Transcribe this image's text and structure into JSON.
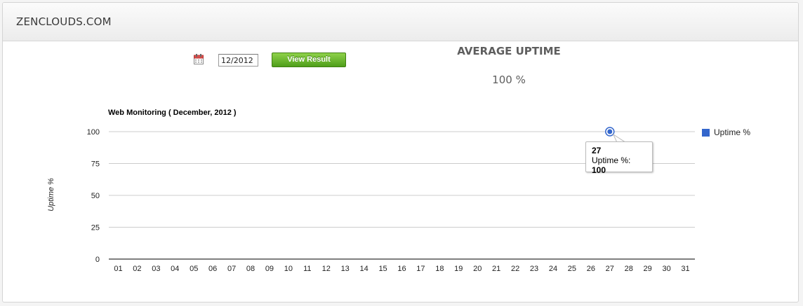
{
  "header": {
    "site_title": "ZENCLOUDS.COM"
  },
  "filter": {
    "calendar_icon": "calendar-icon",
    "month_value": "12/2012",
    "view_button_label": "View Result"
  },
  "summary": {
    "heading": "AVERAGE UPTIME",
    "value": "100 %"
  },
  "colors": {
    "series": "#3366cc",
    "grid": "#cccccc",
    "axis": "#333333",
    "button": "#5aab22"
  },
  "chart_data": {
    "type": "line",
    "title": "Web Monitoring ( December, 2012 )",
    "xlabel": "",
    "ylabel": "Uptime %",
    "ylim": [
      0,
      100
    ],
    "yticks": [
      0,
      25,
      50,
      75,
      100
    ],
    "categories": [
      "01",
      "02",
      "03",
      "04",
      "05",
      "06",
      "07",
      "08",
      "09",
      "10",
      "11",
      "12",
      "13",
      "14",
      "15",
      "16",
      "17",
      "18",
      "19",
      "20",
      "21",
      "22",
      "23",
      "24",
      "25",
      "26",
      "27",
      "28",
      "29",
      "30",
      "31"
    ],
    "series": [
      {
        "name": "Uptime %",
        "points": [
          {
            "x": "27",
            "y": 100
          }
        ]
      }
    ],
    "legend_position": "right",
    "grid": true,
    "tooltip": {
      "x": "27",
      "label": "Uptime %:",
      "value": "100"
    }
  }
}
